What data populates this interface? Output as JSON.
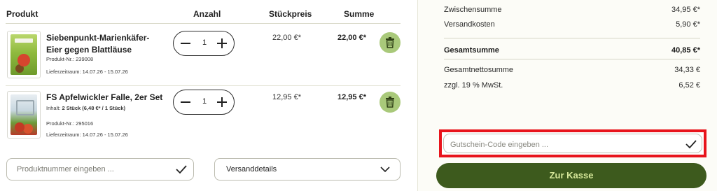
{
  "cart": {
    "headers": {
      "product": "Produkt",
      "quantity": "Anzahl",
      "unit_price": "Stückpreis",
      "total": "Summe"
    },
    "items": [
      {
        "name": "Siebenpunkt-Marienkäfer-Eier gegen Blattläuse",
        "product_no": "Produkt-Nr.: 239008",
        "content": "",
        "delivery": "Lieferzeitraum: 14.07.26 - 15.07.26",
        "quantity": "1",
        "unit_price": "22,00 €*",
        "total": "22,00 €*"
      },
      {
        "name": "FS Apfelwickler Falle, 2er Set",
        "content_label": "Inhalt:",
        "content_value": "2 Stück (6,48 €* / 1 Stück)",
        "product_no": "Produkt-Nr.: 295016",
        "delivery": "Lieferzeitraum: 14.07.26 - 15.07.26",
        "quantity": "1",
        "unit_price": "12,95 €*",
        "total": "12,95 €*"
      }
    ],
    "product_number_input": {
      "placeholder": "Produktnummer eingeben ...",
      "value": ""
    },
    "shipping_details": {
      "label": "Versanddetails"
    }
  },
  "summary": {
    "subtotal_label": "Zwischensumme",
    "subtotal_value": "34,95 €*",
    "shipping_label": "Versandkosten",
    "shipping_value": "5,90 €*",
    "grand_total_label": "Gesamtsumme",
    "grand_total_value": "40,85 €*",
    "net_total_label": "Gesamtnettosumme",
    "net_total_value": "34,33 €",
    "vat_label": "zzgl. 19 % MwSt.",
    "vat_value": "6,52 €",
    "coupon": {
      "placeholder": "Gutschein-Code eingeben ...",
      "value": ""
    },
    "checkout_label": "Zur Kasse"
  },
  "icons": {
    "delete": "trash-icon",
    "confirm": "check-icon",
    "expand": "chevron-down-icon",
    "decrease": "minus-icon",
    "increase": "plus-icon"
  },
  "colors": {
    "checkout_bg": "#3d5a1d",
    "checkout_text": "#d7e89a",
    "delete_bg": "#a9c97a",
    "highlight": "#e8141c"
  }
}
